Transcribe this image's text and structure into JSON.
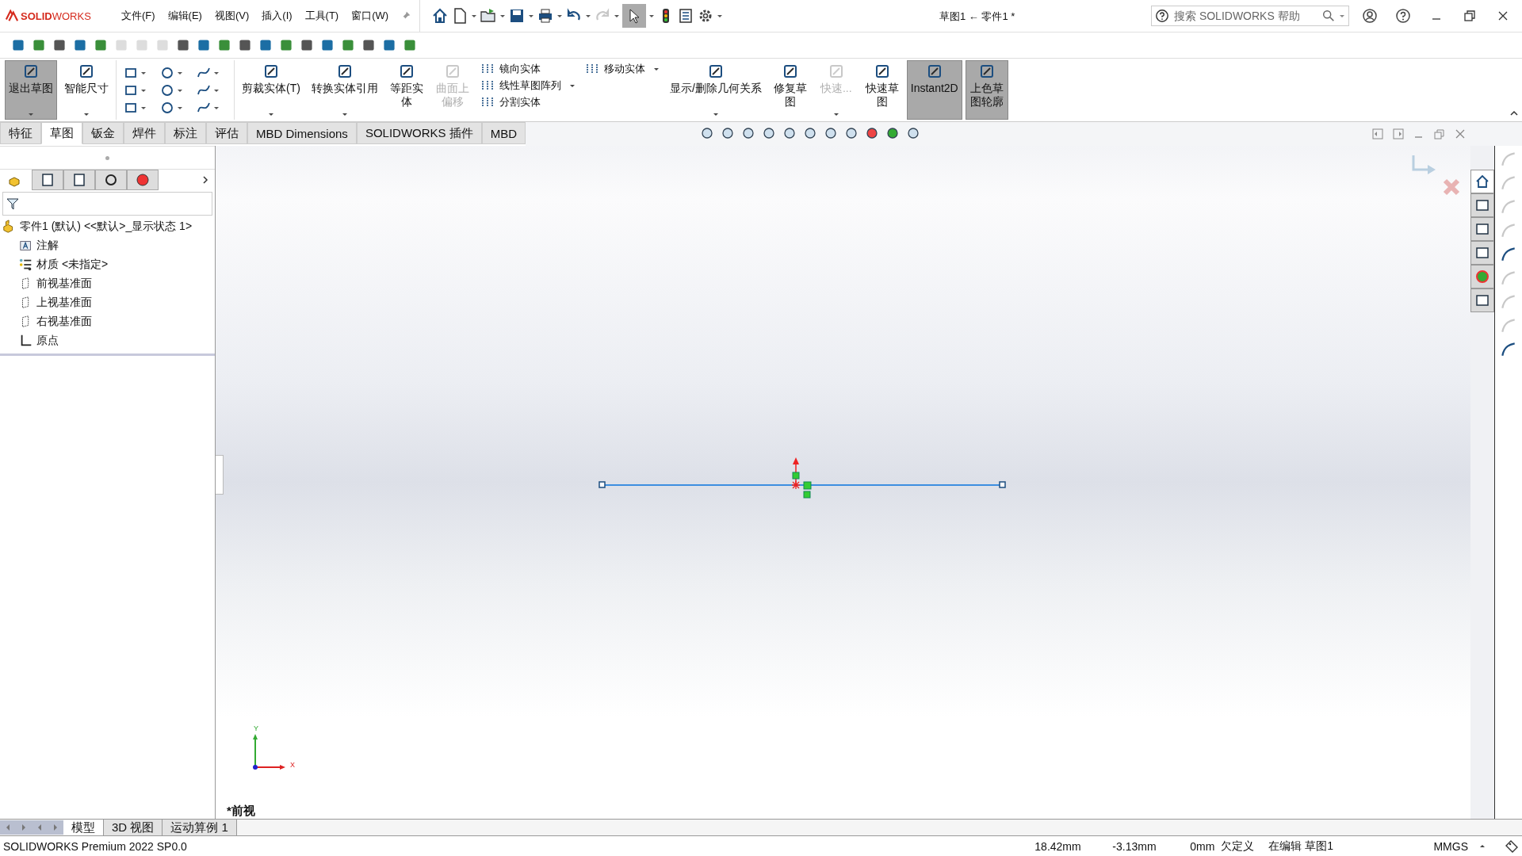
{
  "logo": "**SOLID**WORKS",
  "menus": [
    "文件(F)",
    "编辑(E)",
    "视图(V)",
    "插入(I)",
    "工具(T)",
    "窗口(W)"
  ],
  "title": "草图1 ← 零件1 *",
  "search": {
    "placeholder": "搜索 SOLIDWORKS 帮助"
  },
  "ribbon": [
    {
      "kind": "big",
      "label": "退出草图",
      "selected": true,
      "disabled": false,
      "dropdown": true
    },
    {
      "kind": "big",
      "label": "智能尺寸",
      "selected": false,
      "disabled": false,
      "dropdown": true
    },
    {
      "kind": "grid"
    },
    {
      "kind": "big",
      "label": "剪裁实体(T)",
      "selected": false,
      "disabled": false,
      "dropdown": true
    },
    {
      "kind": "big",
      "label": "转换实体引用",
      "selected": false,
      "disabled": false,
      "dropdown": true
    },
    {
      "kind": "narrow",
      "label": "等距实体",
      "selected": false,
      "disabled": false,
      "dropdown": false
    },
    {
      "kind": "narrow",
      "label": "曲面上偏移",
      "selected": false,
      "disabled": true,
      "dropdown": false
    },
    {
      "kind": "stack",
      "items": [
        {
          "label": "镜向实体",
          "dropdown": false
        },
        {
          "label": "线性草图阵列",
          "dropdown": true
        },
        {
          "label": "分割实体",
          "dropdown": false
        }
      ]
    },
    {
      "kind": "stack",
      "items": [
        {
          "label": "移动实体",
          "dropdown": true
        }
      ]
    },
    {
      "kind": "big",
      "label": "显示/删除几何关系",
      "selected": false,
      "disabled": false,
      "dropdown": true
    },
    {
      "kind": "narrow",
      "label": "修复草图",
      "selected": false,
      "disabled": false,
      "dropdown": false
    },
    {
      "kind": "narrow",
      "label": "快速...",
      "selected": false,
      "disabled": true,
      "dropdown": true
    },
    {
      "kind": "narrow",
      "label": "快速草图",
      "selected": false,
      "disabled": false,
      "dropdown": false
    },
    {
      "kind": "big",
      "label": "Instant2D",
      "selected": true,
      "disabled": false,
      "dropdown": false
    },
    {
      "kind": "narrow",
      "label": "上色草图轮廓",
      "selected": true,
      "disabled": false,
      "dropdown": false
    }
  ],
  "tabs": [
    {
      "label": "特征",
      "selected": false
    },
    {
      "label": "草图",
      "selected": true
    },
    {
      "label": "钣金",
      "selected": false
    },
    {
      "label": "焊件",
      "selected": false
    },
    {
      "label": "标注",
      "selected": false
    },
    {
      "label": "评估",
      "selected": false
    },
    {
      "label": "MBD Dimensions",
      "selected": false
    },
    {
      "label": "SOLIDWORKS 插件",
      "selected": false
    },
    {
      "label": "MBD",
      "selected": false
    }
  ],
  "manager_tabs": [
    {
      "selected": true
    },
    {
      "selected": false
    },
    {
      "selected": false
    },
    {
      "selected": false
    },
    {
      "selected": false
    }
  ],
  "tree": {
    "kind": "part",
    "label": "零件1 (默认) <<默认>_显示状态 1>",
    "children": [
      {
        "kind": "annotations",
        "label": "注解"
      },
      {
        "kind": "material",
        "label": "材质 <未指定>"
      },
      {
        "kind": "plane",
        "label": "前视基准面"
      },
      {
        "kind": "plane",
        "label": "上视基准面"
      },
      {
        "kind": "plane",
        "label": "右视基准面"
      },
      {
        "kind": "origin",
        "label": "原点"
      }
    ]
  },
  "triad": {
    "y": "Y",
    "x": "X"
  },
  "view_label": "*前视",
  "bottom_tabs": [
    {
      "label": "模型",
      "selected": true
    },
    {
      "label": "3D 视图",
      "selected": false
    },
    {
      "label": "运动算例 1",
      "selected": false
    }
  ],
  "status": {
    "product": "SOLIDWORKS Premium 2022 SP0.0",
    "x": "18.42mm",
    "y": "-3.13mm",
    "z": "0mm",
    "state": "欠定义",
    "editing": "在编辑 草图1",
    "units": "MMGS"
  }
}
